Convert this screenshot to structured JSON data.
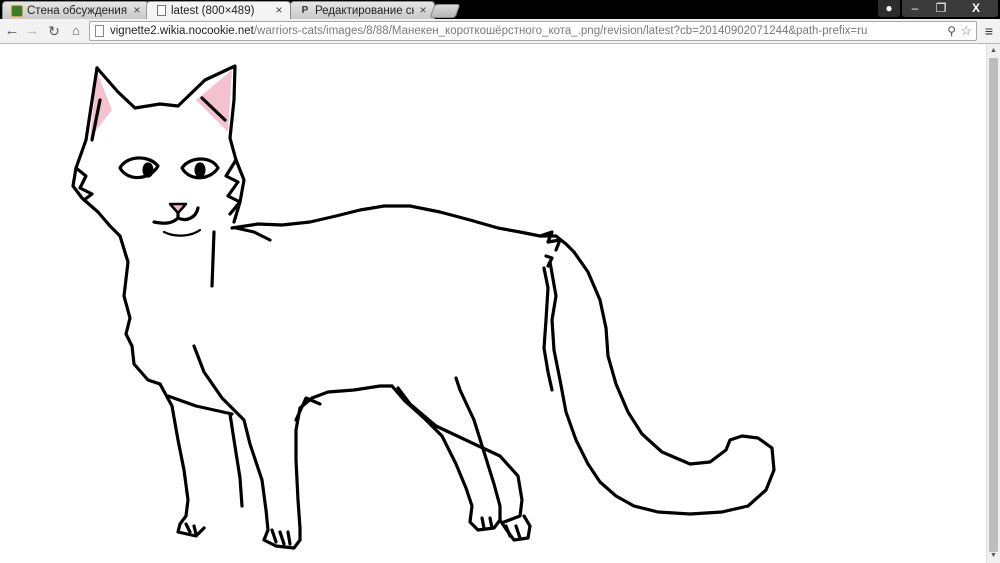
{
  "tabs": [
    {
      "title": "Стена обсуждения:С",
      "icon": "warriors-favicon-icon",
      "close": "×"
    },
    {
      "title": "latest (800×489)",
      "icon": "page-icon",
      "close": "×"
    },
    {
      "title": "Редактирование скр",
      "icon": "p-favicon-icon",
      "icon_glyph": "P",
      "close": "×"
    }
  ],
  "window_controls": {
    "minimize": "‒",
    "maximize": "❐",
    "close": "X",
    "user": "●"
  },
  "toolbar": {
    "back": "←",
    "forward": "→",
    "reload": "↻",
    "home": "⌂",
    "menu": "≡",
    "zoom": "⚲",
    "star": "☆"
  },
  "omnibox": {
    "host": "vignette2.wikia.nocookie.net",
    "path": "/warriors-cats/images/8/88/Манекен_короткошёрстного_кота_.png/revision/latest?cb=20140902071244&path-prefix=ru"
  },
  "content": {
    "image": "cat-lineart",
    "colors": {
      "ear_inner": "#f4c2cf",
      "nose": "#f2b8c6",
      "outline": "#000000"
    }
  }
}
